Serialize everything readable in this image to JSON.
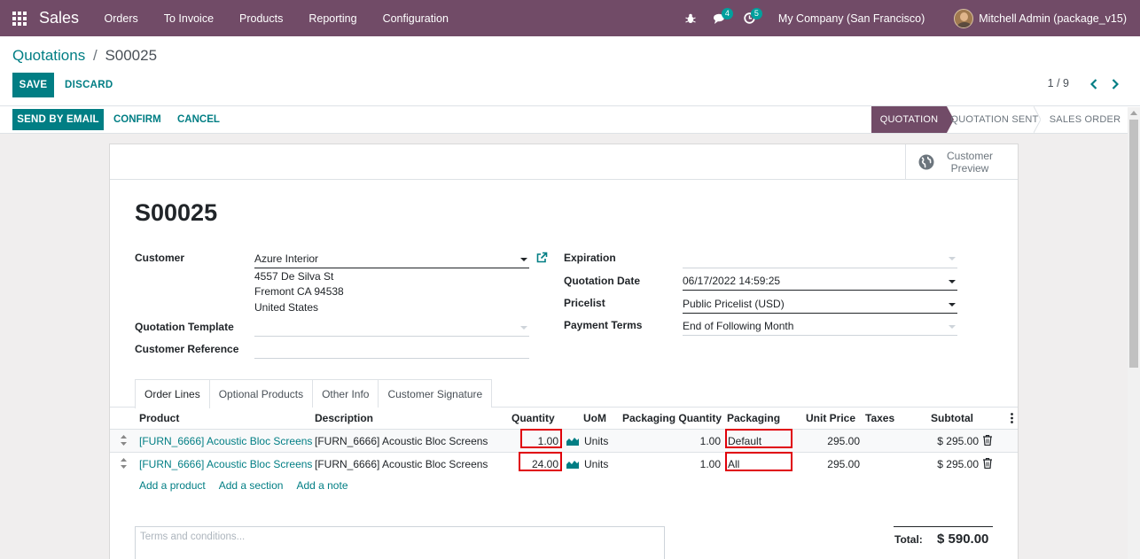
{
  "navbar": {
    "app_name": "Sales",
    "menu": [
      "Orders",
      "To Invoice",
      "Products",
      "Reporting",
      "Configuration"
    ],
    "chat_count": "4",
    "activity_count": "5",
    "company": "My Company (San Francisco)",
    "user": "Mitchell Admin (package_v15)"
  },
  "breadcrumb": {
    "parent": "Quotations",
    "separator": "/",
    "current": "S00025"
  },
  "actions": {
    "save": "SAVE",
    "discard": "DISCARD",
    "pager": "1 / 9"
  },
  "statusbar": {
    "send_email": "SEND BY EMAIL",
    "confirm": "CONFIRM",
    "cancel": "CANCEL",
    "stages": [
      "QUOTATION",
      "QUOTATION SENT",
      "SALES ORDER"
    ],
    "active_stage": "QUOTATION"
  },
  "buttonbox": {
    "preview_line1": "Customer",
    "preview_line2": "Preview"
  },
  "form": {
    "name": "S00025",
    "customer_label": "Customer",
    "customer_value": "Azure Interior",
    "address": [
      "4557 De Silva St",
      "Fremont CA 94538",
      "United States"
    ],
    "template_label": "Quotation Template",
    "template_value": "",
    "reference_label": "Customer Reference",
    "reference_value": "",
    "expiration_label": "Expiration",
    "expiration_value": "",
    "date_label": "Quotation Date",
    "date_value": "06/17/2022 14:59:25",
    "pricelist_label": "Pricelist",
    "pricelist_value": "Public Pricelist (USD)",
    "terms_label": "Payment Terms",
    "terms_value": "End of Following Month"
  },
  "tabs": [
    "Order Lines",
    "Optional Products",
    "Other Info",
    "Customer Signature"
  ],
  "table": {
    "headers": [
      "Product",
      "Description",
      "Quantity",
      "UoM",
      "Packaging Quantity",
      "Packaging",
      "Unit Price",
      "Taxes",
      "Subtotal"
    ],
    "rows": [
      {
        "product": "[FURN_6666] Acoustic Bloc Screens",
        "description": "[FURN_6666] Acoustic Bloc Screens",
        "quantity": "1.00",
        "uom": "Units",
        "pkg_qty": "1.00",
        "packaging": "Default",
        "unit_price": "295.00",
        "taxes": "",
        "subtotal": "$ 295.00"
      },
      {
        "product": "[FURN_6666] Acoustic Bloc Screens",
        "description": "[FURN_6666] Acoustic Bloc Screens",
        "quantity": "24.00",
        "uom": "Units",
        "pkg_qty": "1.00",
        "packaging": "All",
        "unit_price": "295.00",
        "taxes": "",
        "subtotal": "$ 295.00"
      }
    ],
    "add_product": "Add a product",
    "add_section": "Add a section",
    "add_note": "Add a note"
  },
  "footer": {
    "terms_placeholder": "Terms and conditions...",
    "total_label": "Total:",
    "total_value": "$ 590.00"
  },
  "colors": {
    "brand": "#714b67",
    "primary": "#017e84",
    "highlight": "#e0000a"
  }
}
